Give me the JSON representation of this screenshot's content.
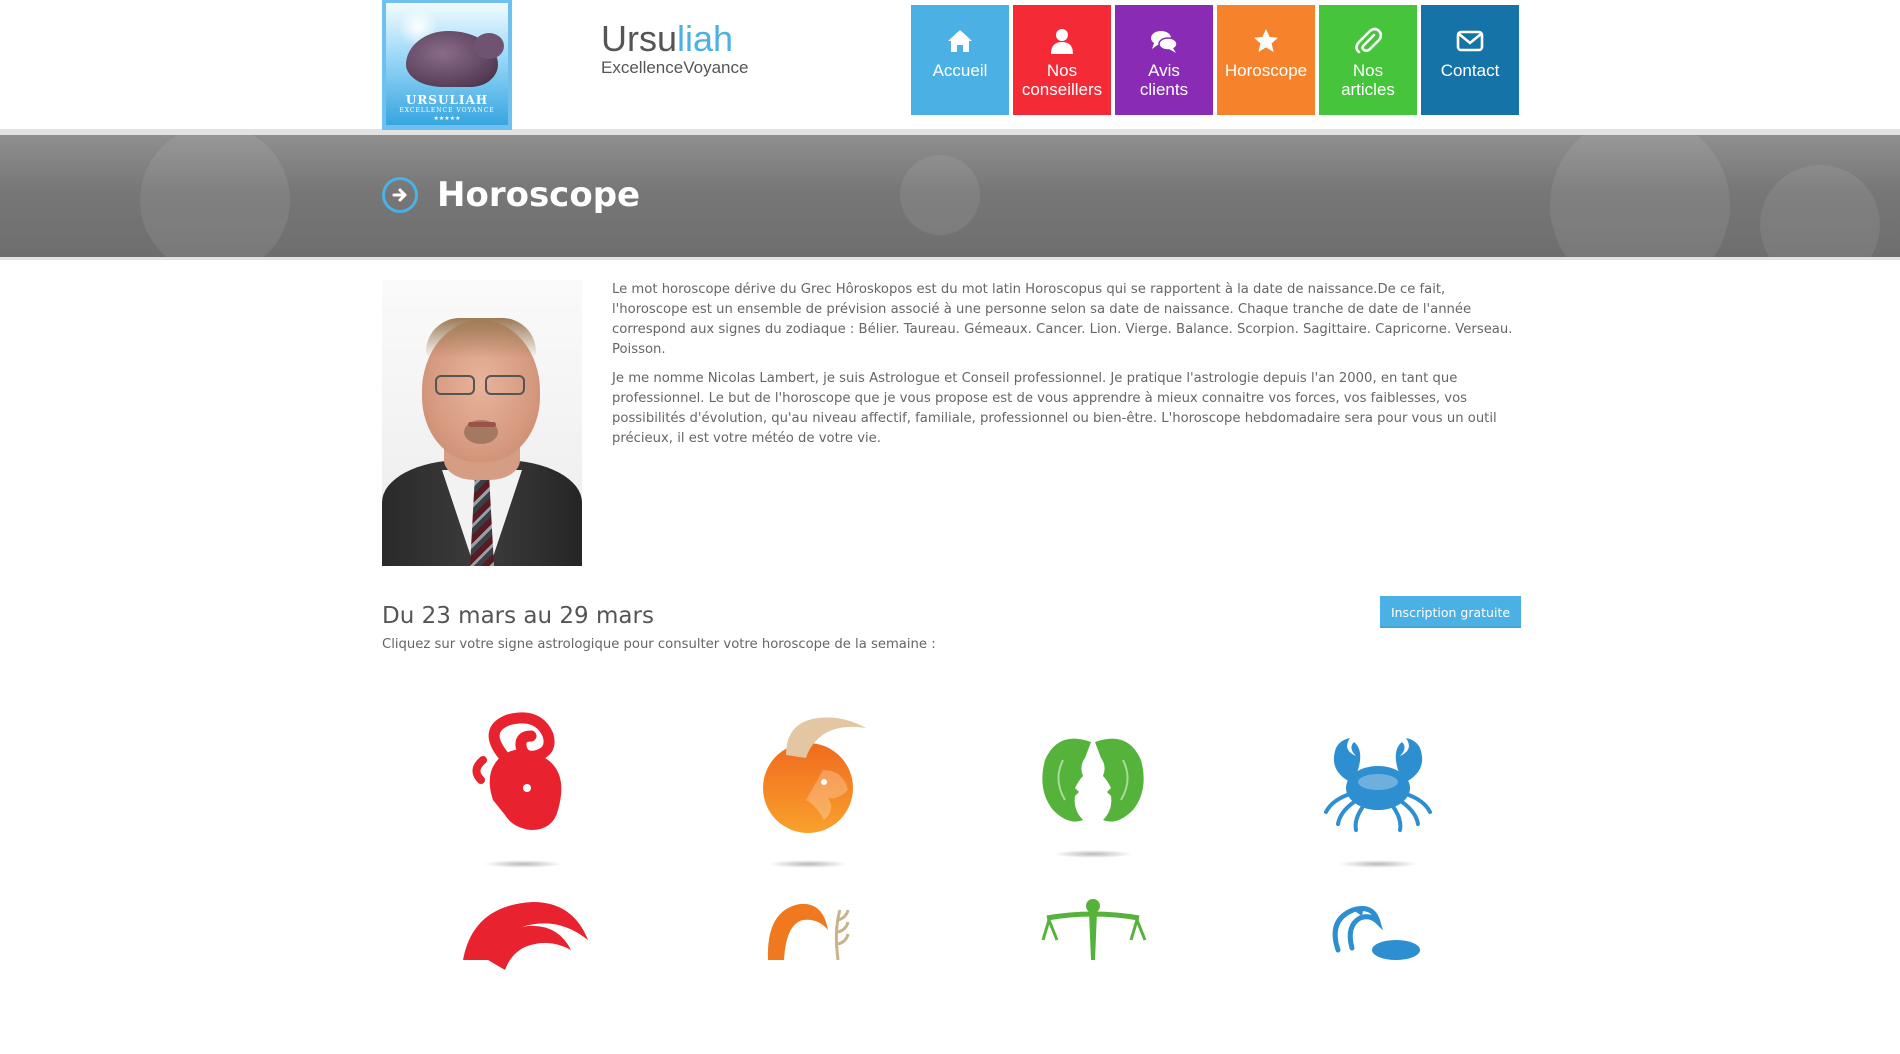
{
  "brand": {
    "logo_text": "URSULIAH",
    "logo_subtext": "EXCELLENCE VOYANCE",
    "title_main": "Ursu",
    "title_accent": "liah",
    "subtitle": "ExcellenceVoyance"
  },
  "nav": [
    {
      "label": "Accueil",
      "icon": "home-icon",
      "color": "#4bb1e5"
    },
    {
      "label": "Nos\nconseillers",
      "icon": "user-icon",
      "color": "#f42a36"
    },
    {
      "label": "Avis\nclients",
      "icon": "comments-icon",
      "color": "#8a2bb5"
    },
    {
      "label": "Horoscope",
      "icon": "star-icon",
      "color": "#f6832c",
      "active": true
    },
    {
      "label": "Nos\narticles",
      "icon": "paperclip-icon",
      "color": "#45c43c"
    },
    {
      "label": "Contact",
      "icon": "envelope-icon",
      "color": "#1573a8"
    }
  ],
  "banner": {
    "title": "Horoscope",
    "icon": "arrow-circle-right-icon"
  },
  "intro": {
    "paragraph1": "Le mot horoscope dérive du Grec Hôroskopos est du mot latin Horoscopus qui se rapportent à la date de naissance.De ce fait, l'horoscope est un ensemble de prévision associé à une personne selon sa date de naissance. Chaque tranche de date de l'année correspond aux signes du zodiaque : Bélier. Taureau. Gémeaux. Cancer. Lion. Vierge. Balance. Scorpion. Sagittaire. Capricorne. Verseau. Poisson.",
    "paragraph2": "Je me nomme Nicolas Lambert, je suis Astrologue et Conseil professionnel. Je pratique l'astrologie depuis l'an 2000, en tant que professionnel. Le but de l'horoscope que je vous propose est de vous apprendre à mieux connaitre vos forces, vos faiblesses, vos possibilités d'évolution, qu'au niveau affectif, familiale, professionnel ou bien-être. L'horoscope hebdomadaire sera pour vous un outil précieux, il est votre météo de votre vie."
  },
  "horoscope": {
    "week_title": "Du 23 mars au 29 mars",
    "signup_label": "Inscription gratuite",
    "instruction": "Cliquez sur votre signe astrologique pour consulter votre horoscope de la semaine :",
    "signs": [
      {
        "icon": "aries-icon",
        "color": "#e8232f"
      },
      {
        "icon": "taurus-icon",
        "color": "#f0781e"
      },
      {
        "icon": "gemini-icon",
        "color": "#55b23a"
      },
      {
        "icon": "cancer-icon",
        "color": "#2e8fd0"
      },
      {
        "icon": "leo-icon",
        "color": "#e8232f"
      },
      {
        "icon": "virgo-icon",
        "color": "#f0781e"
      },
      {
        "icon": "libra-icon",
        "color": "#55b23a"
      },
      {
        "icon": "scorpio-icon",
        "color": "#2e8fd0"
      }
    ]
  }
}
